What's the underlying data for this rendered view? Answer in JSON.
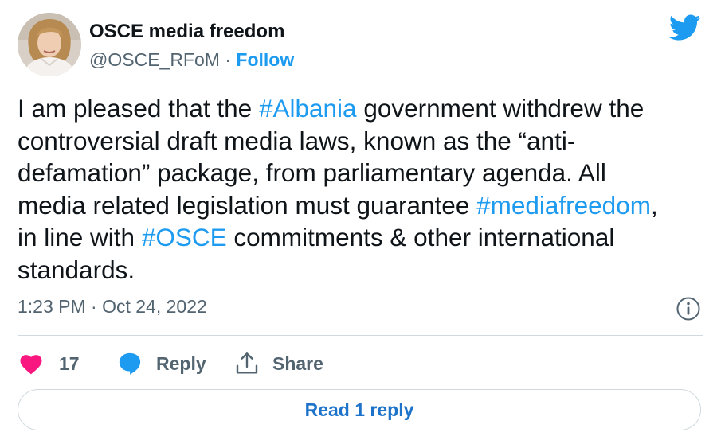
{
  "author": {
    "display_name": "OSCE media freedom",
    "handle": "@OSCE_RFoM",
    "separator": "·",
    "follow_label": "Follow"
  },
  "tweet": {
    "lines": [
      [
        {
          "t": "I am pleased that the "
        },
        {
          "t": "#Albania",
          "tag": true
        },
        {
          "t": " government withdrew the"
        }
      ],
      [
        {
          "t": "controversial draft media laws, known as the “anti-"
        }
      ],
      [
        {
          "t": "defamation” package, from parliamentary agenda. All"
        }
      ],
      [
        {
          "t": "media related legislation must guarantee "
        },
        {
          "t": "#mediafreedom",
          "tag": true
        },
        {
          "t": ","
        }
      ],
      [
        {
          "t": "in line with "
        },
        {
          "t": "#OSCE",
          "tag": true
        },
        {
          "t": " commitments & other international"
        }
      ],
      [
        {
          "t": "standards."
        }
      ]
    ],
    "timestamp": "1:23 PM · Oct 24, 2022"
  },
  "actions": {
    "like_count": "17",
    "reply_label": "Reply",
    "share_label": "Share"
  },
  "read_replies_label": "Read 1 reply",
  "colors": {
    "accent": "#1d9bf0",
    "like": "#f91880",
    "text": "#0f1419",
    "muted": "#536471",
    "border": "#cfd9de"
  },
  "icons": [
    "twitter-bird-icon",
    "info-icon",
    "heart-icon",
    "reply-bubble-icon",
    "share-icon"
  ]
}
